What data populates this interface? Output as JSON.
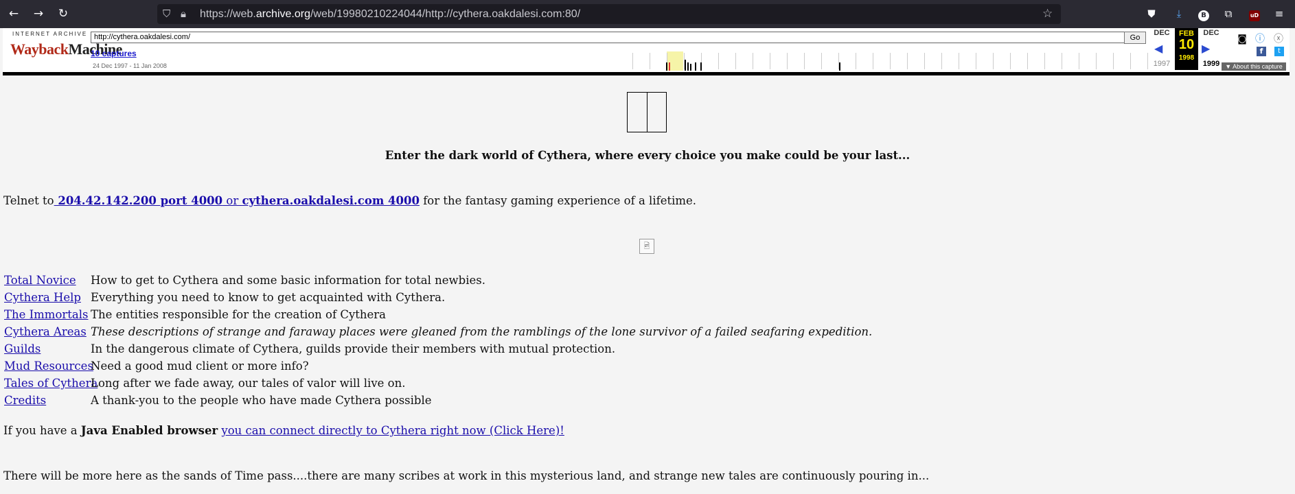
{
  "browser": {
    "url_prefix": "https://web.",
    "url_domain": "archive.org",
    "url_rest": "/web/19980210224044/http://cythera.oakdalesi.com:80/",
    "icons": [
      "back-icon",
      "forward-icon",
      "reload-icon",
      "shield-icon",
      "lock-icon",
      "star-icon",
      "pocket-icon",
      "download-icon",
      "profile-icon",
      "extensions-icon",
      "ublock-icon",
      "menu-icon"
    ],
    "ublock_label": "uD"
  },
  "wayback": {
    "logo_top": "INTERNET ARCHIVE",
    "logo_main_red": "Wayback",
    "logo_main_dark": "Machine",
    "url_value": "http://cythera.oakdalesi.com/",
    "go_label": "Go",
    "captures": "10 captures",
    "range": "24 Dec 1997 - 11 Jan 2008",
    "prev_month": "DEC",
    "prev_year": "1997",
    "cur_month": "FEB",
    "cur_day": "10",
    "cur_year": "1998",
    "next_month": "DEC",
    "next_year": "1999",
    "about": "▼ About this capture",
    "colors": {
      "logo_red": "#b12a19",
      "highlight": "#f6f4a8",
      "current_bg": "#000000",
      "current_fg": "#ffea00",
      "link": "#1a1acc"
    }
  },
  "page": {
    "tagline": "Enter the dark world of Cythera, where every choice you make could be your last...",
    "telnet_prefix": "Telnet to",
    "telnet_link_bold": " 204.42.142.200 port 4000",
    "telnet_or": " or ",
    "telnet_host": "cythera.oakdalesi.com 4000",
    "telnet_suffix": " for the fantasy gaming experience of a lifetime.",
    "menu": [
      {
        "label": "Total Novice",
        "desc": "How to get to Cythera and some basic information for total newbies."
      },
      {
        "label": "Cythera Help",
        "desc": "Everything you need to know to get acquainted with Cythera."
      },
      {
        "label": "The Immortals",
        "desc": "The entities responsible for the creation of Cythera"
      },
      {
        "label": "Cythera Areas",
        "desc": "These descriptions of strange and faraway places were gleaned from the ramblings of the lone survivor of a failed seafaring expedition."
      },
      {
        "label": "Guilds",
        "desc": "In the dangerous climate of Cythera, guilds provide their members with mutual protection."
      },
      {
        "label": "Mud Resources",
        "desc": "Need a good mud client or more info?"
      },
      {
        "label": "Tales of Cythera",
        "desc": "Long after we fade away, our tales of valor will live on."
      },
      {
        "label": "Credits",
        "desc": "A thank-you to the people who have made Cythera possible"
      }
    ],
    "java_prefix": "If you have a ",
    "java_bold": "Java Enabled browser",
    "java_link": "you can connect directly to Cythera right now (Click Here)!",
    "footer": "There will be more here as the sands of Time pass....there are many scribes at work in this mysterious land, and strange new tales are continuously pouring in..."
  }
}
